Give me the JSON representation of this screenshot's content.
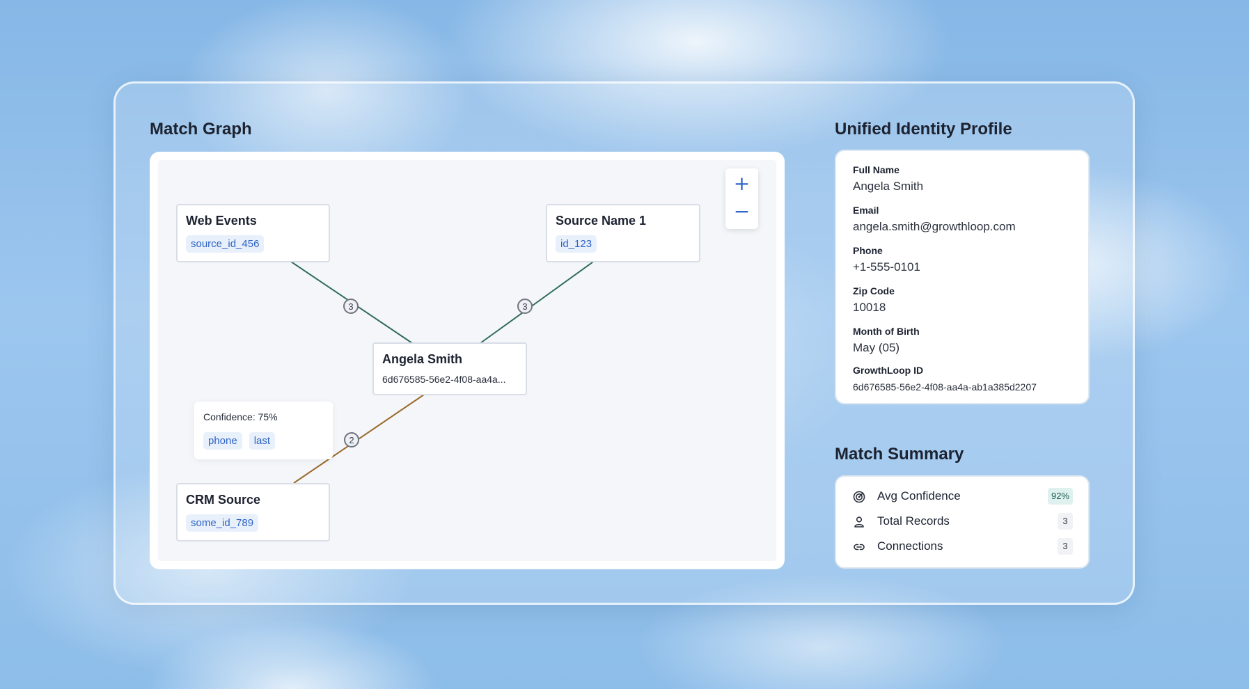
{
  "match_graph": {
    "title": "Match Graph",
    "zoom_in_label": "+",
    "zoom_out_label": "−",
    "nodes": {
      "web_events": {
        "title": "Web Events",
        "id": "source_id_456"
      },
      "source_name_1": {
        "title": "Source Name 1",
        "id": "id_123"
      },
      "center": {
        "title": "Angela Smith",
        "id": "6d676585-56e2-4f08-aa4a..."
      },
      "crm_source": {
        "title": "CRM Source",
        "id": "some_id_789"
      }
    },
    "edges": [
      {
        "from": "web_events",
        "to": "center",
        "count": "3",
        "color": "#2f6b5a"
      },
      {
        "from": "source_name_1",
        "to": "center",
        "count": "3",
        "color": "#2f6b5a"
      },
      {
        "from": "crm_source",
        "to": "center",
        "count": "2",
        "color": "#9a6a2a"
      }
    ],
    "tooltip": {
      "confidence_text": "Confidence: 75%",
      "fields": [
        "phone",
        "last"
      ]
    }
  },
  "profile": {
    "title": "Unified Identity Profile",
    "fields": [
      {
        "label": "Full Name",
        "value": "Angela Smith"
      },
      {
        "label": "Email",
        "value": "angela.smith@growthloop.com"
      },
      {
        "label": "Phone",
        "value": "+1-555-0101"
      },
      {
        "label": "Zip Code",
        "value": "10018"
      },
      {
        "label": "Month of Birth",
        "value": "May (05)"
      },
      {
        "label": "GrowthLoop ID",
        "value": "6d676585-56e2-4f08-aa4a-ab1a385d2207"
      }
    ]
  },
  "summary": {
    "title": "Match Summary",
    "rows": [
      {
        "icon": "target-icon",
        "label": "Avg Confidence",
        "value": "92%"
      },
      {
        "icon": "user-icon",
        "label": "Total Records",
        "value": "3"
      },
      {
        "icon": "link-icon",
        "label": "Connections",
        "value": "3"
      }
    ]
  },
  "colors": {
    "accent_blue": "#2f64c6",
    "edge_green": "#2f6b5a",
    "edge_orange": "#9a6a2a",
    "confidence_badge_bg": "#dff1ee"
  }
}
